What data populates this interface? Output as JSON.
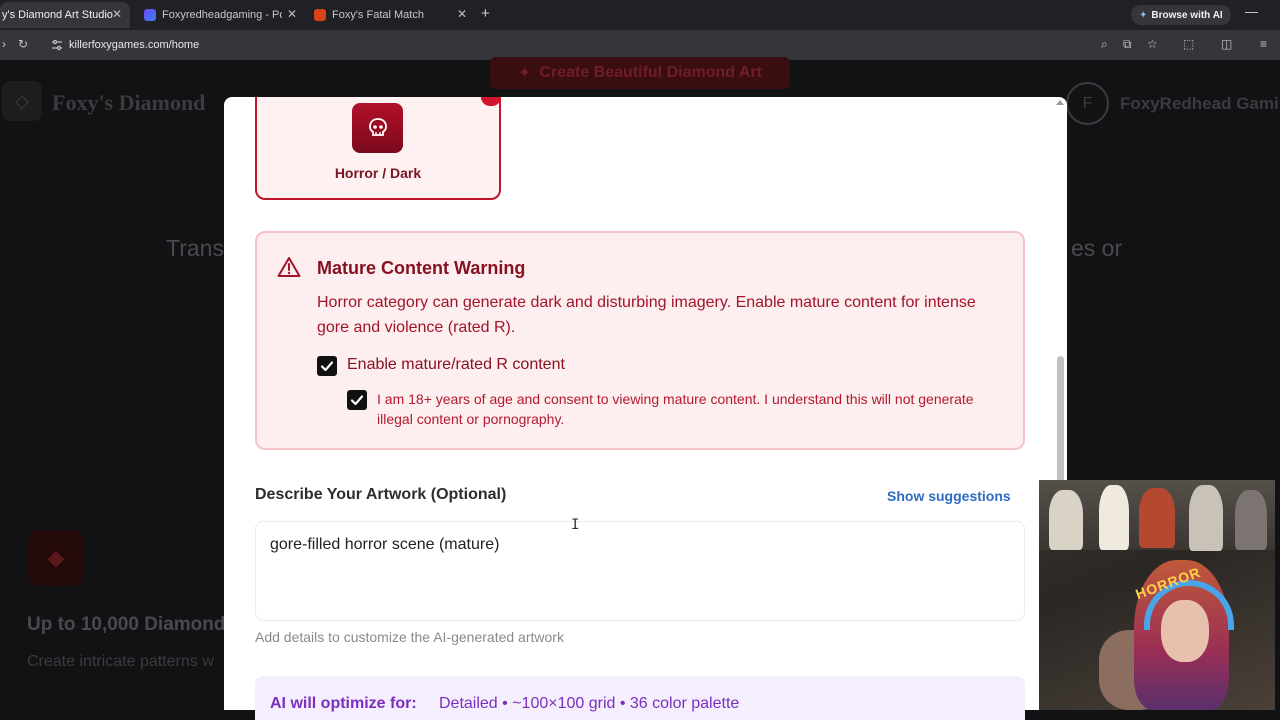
{
  "browser": {
    "tabs": [
      {
        "title": "y's Diamond Art Studio",
        "favicon_color": "#e4202e"
      },
      {
        "title": "Foxyredheadgaming - Poster (U",
        "favicon_color": "#3c7cf0"
      },
      {
        "title": "Foxy's Fatal Match",
        "favicon_color": "#d8431c"
      }
    ],
    "new_tab": "+",
    "ai_button": "Browse with AI",
    "url": "killerfoxygames.com/home"
  },
  "background_page": {
    "brand": "Foxy's Diamond",
    "create_button": "Create Beautiful Diamond Art",
    "avatar_initial": "F",
    "username": "FoxyRedhead Gamin",
    "hero_left": "Trans",
    "hero_right": "es or",
    "feature_title": "Up to 10,000 Diamond",
    "feature_sub": "Create intricate patterns w"
  },
  "modal": {
    "style_card": {
      "label": "Horror / Dark",
      "icon": "skull-icon"
    },
    "warning": {
      "title": "Mature Content Warning",
      "body": "Horror category can generate dark and disturbing imagery. Enable mature content for intense gore and violence (rated R).",
      "enable_label": "Enable mature/rated R content",
      "enable_checked": true,
      "consent_label": "I am 18+ years of age and consent to viewing mature content. I understand this will not generate illegal content or pornography.",
      "consent_checked": true
    },
    "description": {
      "title": "Describe Your Artwork (Optional)",
      "suggestions_link": "Show suggestions",
      "value": "gore-filled horror scene (mature)",
      "help": "Add details to customize the AI-generated artwork"
    },
    "ai_optimize": {
      "label": "AI will optimize for:",
      "details": "Detailed • ~100×100 grid • 36 color palette"
    }
  },
  "webcam": {
    "shirt_text": "HORROR"
  },
  "colors": {
    "accent_red": "#c0152a",
    "warning_bg": "#fdeeef",
    "link_blue": "#2e6cbf",
    "ai_purple": "#7a2fc0"
  }
}
